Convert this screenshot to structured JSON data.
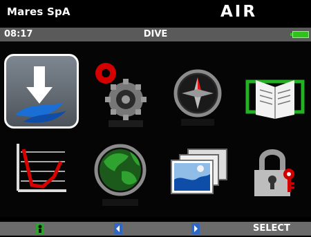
{
  "header": {
    "brand": "Mares SpA",
    "mode": "AIR"
  },
  "status": {
    "time": "08:17",
    "title": "DIVE",
    "battery": "battery-full-icon"
  },
  "menu": {
    "items": [
      {
        "name": "download-icon",
        "selected": true
      },
      {
        "name": "settings-gears-icon"
      },
      {
        "name": "compass-icon"
      },
      {
        "name": "logbook-icon"
      },
      {
        "name": "dive-profile-chart-icon"
      },
      {
        "name": "globe-icon"
      },
      {
        "name": "photo-gallery-icon"
      },
      {
        "name": "lock-icon"
      }
    ]
  },
  "footer": {
    "select_label": "SELECT"
  },
  "colors": {
    "battery": "#2ec21a",
    "softkey": "#2f67c8",
    "softkey_green": "#2ea12e"
  }
}
